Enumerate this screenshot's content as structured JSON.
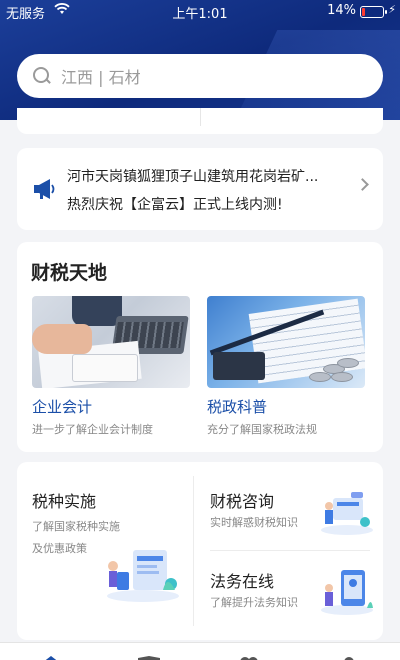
{
  "status_bar": {
    "carrier": "无服务",
    "time": "上午1:01",
    "battery": "14%",
    "battery_level": 0.14
  },
  "search": {
    "placeholder": "江西 | 石材",
    "icon": "search-icon"
  },
  "notice": {
    "icon": "megaphone-icon",
    "line1": "河市天岗镇狐狸顶子山建筑用花岗岩矿...",
    "line2": "热烈庆祝【企富云】正式上线内测!"
  },
  "finance": {
    "title": "财税天地",
    "tiles": [
      {
        "name": "企业会计",
        "desc": "进一步了解企业会计制度"
      },
      {
        "name": "税政科普",
        "desc": "充分了解国家税政法规"
      }
    ]
  },
  "services": {
    "items": [
      {
        "title": "税种实施",
        "desc_line1": "了解国家税种实施",
        "desc_line2": "及优惠政策"
      },
      {
        "title": "财税咨询",
        "desc": "实时解惑财税知识"
      },
      {
        "title": "法务在线",
        "desc": "了解提升法务知识"
      }
    ]
  },
  "colors": {
    "header": "#0e2a7c",
    "accent": "#1b4fa8"
  }
}
